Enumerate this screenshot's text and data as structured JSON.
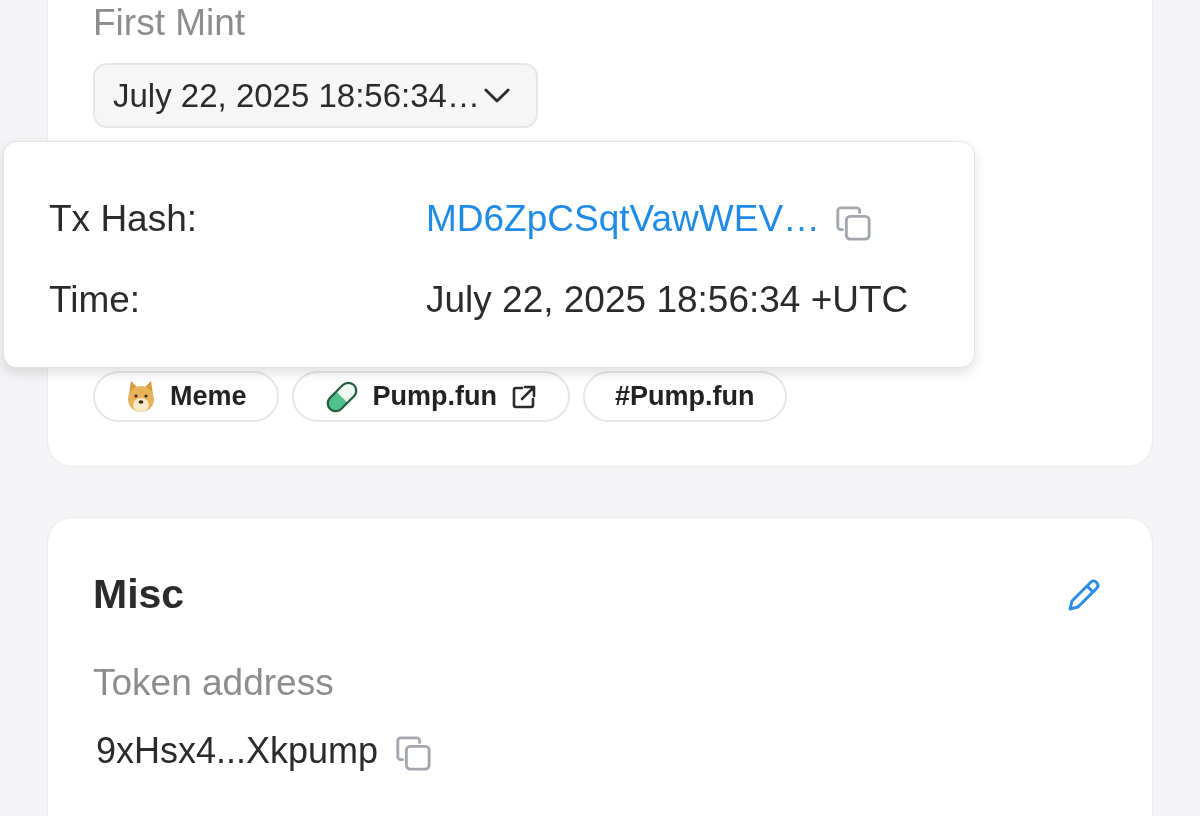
{
  "first_mint": {
    "label": "First Mint",
    "value": "July 22, 2025 18:56:34…"
  },
  "mint_tooltip": {
    "rows": [
      {
        "kind": "link",
        "label": "Tx Hash:",
        "value": "MD6ZpCSqtVawWEV…"
      },
      {
        "kind": "text",
        "label": "Time:",
        "value": "July 22, 2025 18:56:34 +UTC"
      }
    ]
  },
  "tags": [
    {
      "kind": "category",
      "label": "Meme"
    },
    {
      "kind": "platform",
      "label": "Pump.fun"
    },
    {
      "kind": "hashtag",
      "label": "#Pump.fun"
    }
  ],
  "misc": {
    "title": "Misc",
    "fields": [
      {
        "label": "Token address",
        "value": "9xHsx4...Xkpump"
      }
    ]
  }
}
